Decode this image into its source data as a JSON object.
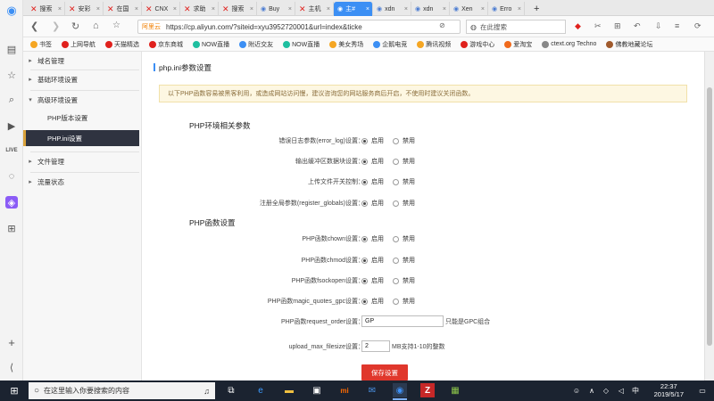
{
  "browser": {
    "tabs": [
      {
        "label": "搜索",
        "status": "error"
      },
      {
        "label": "安彩",
        "status": "error"
      },
      {
        "label": "在国",
        "status": "error"
      },
      {
        "label": "CNX",
        "status": "error"
      },
      {
        "label": "求助",
        "status": "error"
      },
      {
        "label": "搜索",
        "status": "error"
      },
      {
        "label": "Buy",
        "status": "favicon"
      },
      {
        "label": "主机",
        "status": "error"
      },
      {
        "label": "主#",
        "status": "active"
      },
      {
        "label": "xdn",
        "status": "favicon"
      },
      {
        "label": "xdn",
        "status": "favicon"
      },
      {
        "label": "Xen",
        "status": "favicon"
      },
      {
        "label": "Erro",
        "status": "favicon"
      }
    ],
    "new_tab_symbol": "+",
    "site_badge": "阿里云",
    "url": "https://cp.aliyun.com/?siteid=xyu3952720001&url=index&ticke",
    "search_placeholder": "在此搜索",
    "bookmarks": [
      {
        "label": "书签",
        "color": "#f5a623"
      },
      {
        "label": "上网导航",
        "color": "#e0211d"
      },
      {
        "label": "天猫精选",
        "color": "#e0211d"
      },
      {
        "label": "京东商城",
        "color": "#e0211d"
      },
      {
        "label": "NOW直播",
        "color": "#1fbfa0"
      },
      {
        "label": "附近交友",
        "color": "#3c8ff4"
      },
      {
        "label": "NOW直播",
        "color": "#1fbfa0"
      },
      {
        "label": "美女秀场",
        "color": "#f5a623"
      },
      {
        "label": "企鹅电竞",
        "color": "#3c8ff4"
      },
      {
        "label": "腾讯视频",
        "color": "#f5a623"
      },
      {
        "label": "游戏中心",
        "color": "#e0211d"
      },
      {
        "label": "爱淘宝",
        "color": "#f06a1c"
      },
      {
        "label": "ctext.org Techno",
        "color": "#888888"
      },
      {
        "label": "佛教地藏论坛",
        "color": "#a05a2c"
      }
    ]
  },
  "sidebar": {
    "items": [
      {
        "label": "域名管理",
        "arrow": "▸"
      },
      {
        "label": "基础环境设置",
        "arrow": "▸"
      },
      {
        "label": "高级环境设置",
        "arrow": "▾"
      },
      {
        "label": "PHP版本设置"
      },
      {
        "label": "PHP.ini设置"
      },
      {
        "label": "文件管理",
        "arrow": "▸"
      },
      {
        "label": "流量状态",
        "arrow": "▸"
      }
    ]
  },
  "main": {
    "title": "php.ini参数设置",
    "notice": "以下PHP函数容易被黑客利用，或造成网站访问慢，建议咨询您的网站服务商后开启，不使用时建议关闭函数。",
    "section_env": "PHP环境相关参数",
    "section_func": "PHP函数设置",
    "option_on": "启用",
    "option_off": "禁用",
    "env_rows": [
      {
        "label": "错误日志参数(error_log)设置：",
        "value": "启用"
      },
      {
        "label": "输出缓冲区数据块设置：",
        "value": "启用"
      },
      {
        "label": "上传文件开关控制：",
        "value": "启用"
      },
      {
        "label": "注册全局参数(register_globals)设置：",
        "value": "启用"
      }
    ],
    "func_rows": [
      {
        "label": "PHP函数chown设置：",
        "value": "启用"
      },
      {
        "label": "PHP函数chmod设置：",
        "value": "启用"
      },
      {
        "label": "PHP函数fsockopen设置：",
        "value": "启用"
      },
      {
        "label": "PHP函数magic_quotes_gpc设置：",
        "value": "启用"
      }
    ],
    "request_order": {
      "label": "PHP函数request_order设置：",
      "value": "GP",
      "hint": "只能是GPC组合"
    },
    "upload_max": {
      "label": "upload_max_filesize设置：",
      "value": "2",
      "hint": "MB支持1-10的整数"
    },
    "save_label": "保存设置"
  },
  "taskbar": {
    "search_placeholder": "在这里输入你要搜索的内容",
    "time": "22:37",
    "date": "2019/5/17",
    "ime": "中"
  }
}
